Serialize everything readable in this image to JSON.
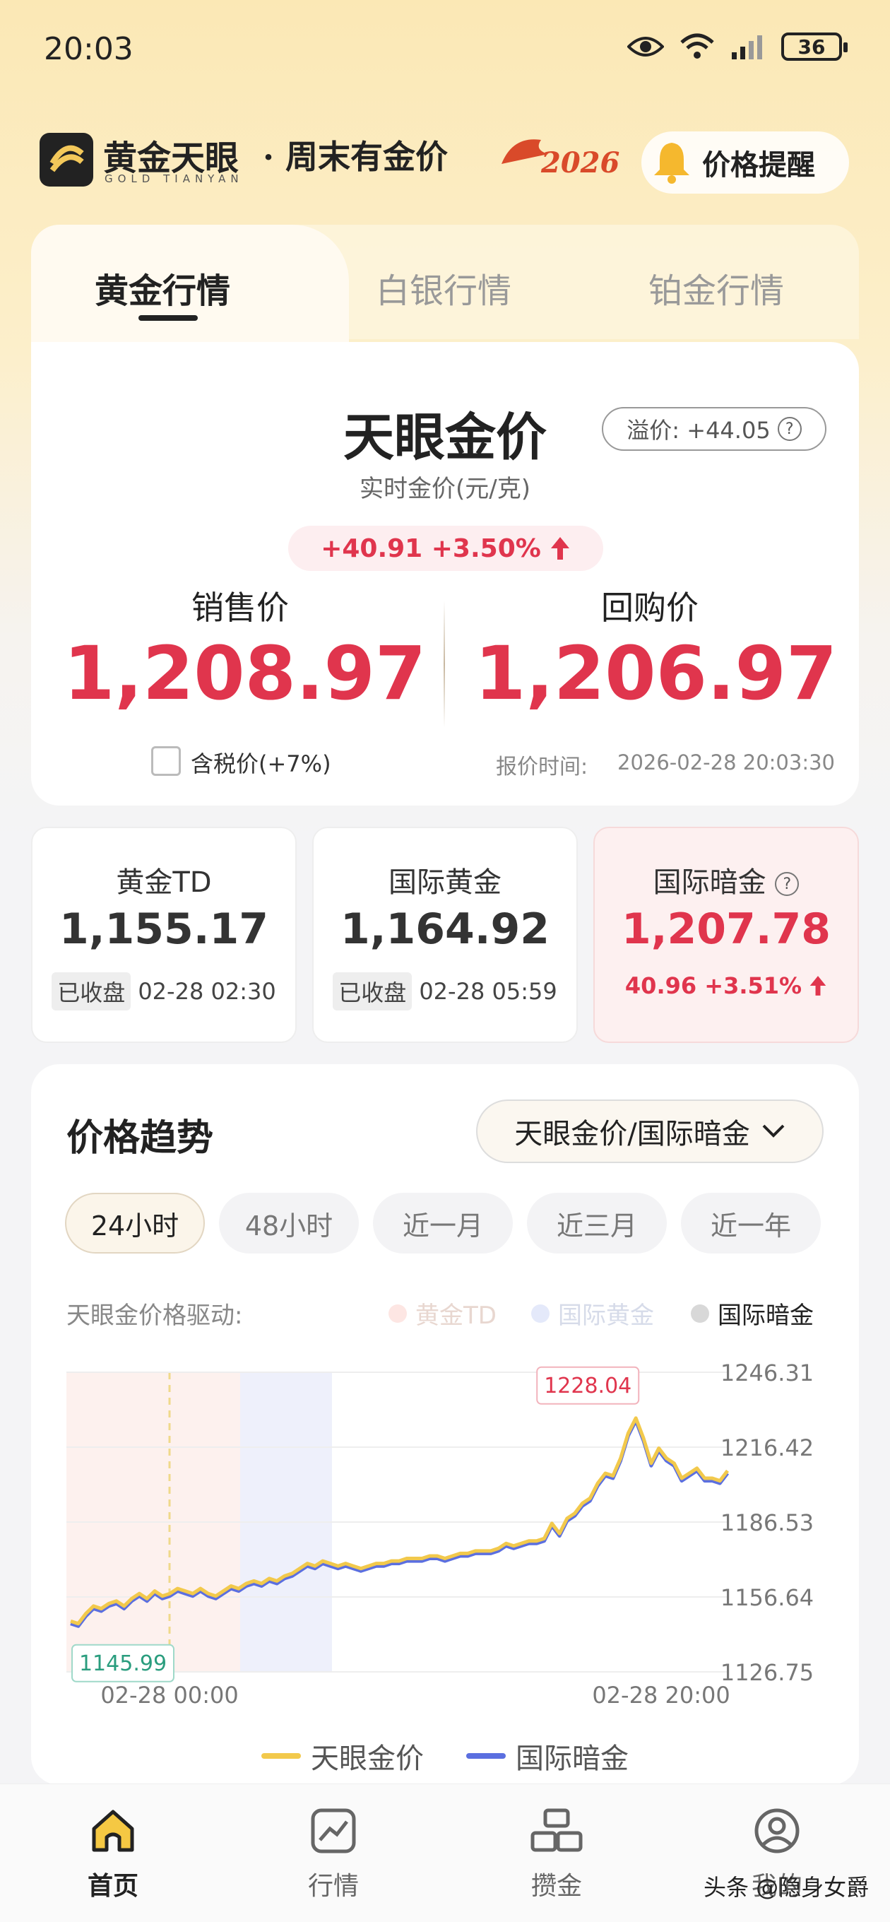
{
  "status_bar": {
    "time": "20:03",
    "battery": "36"
  },
  "header": {
    "brand_name": "黄金天眼",
    "brand_sub": "GOLD TIANYAN",
    "slogan": "· 周末有金价",
    "year_badge": "2026",
    "alert_button": "价格提醒"
  },
  "tabs": [
    {
      "label": "黄金行情",
      "active": true
    },
    {
      "label": "白银行情",
      "active": false
    },
    {
      "label": "铂金行情",
      "active": false
    }
  ],
  "price_card": {
    "title": "天眼金价",
    "premium": "溢价: +44.05",
    "unit": "实时金价(元/克)",
    "change": "+40.91 +3.50%",
    "sell_label": "销售价",
    "sell_price": "1,208.97",
    "buy_label": "回购价",
    "buy_price": "1,206.97",
    "tax_label": "含税价(+7%)",
    "quote_time_label": "报价时间:",
    "quote_time": "2026-02-28 20:03:30"
  },
  "markets": [
    {
      "name": "黄金TD",
      "value": "1,155.17",
      "status": "已收盘",
      "time": "02-28 02:30"
    },
    {
      "name": "国际黄金",
      "value": "1,164.92",
      "status": "已收盘",
      "time": "02-28 05:59"
    },
    {
      "name": "国际暗金",
      "value": "1,207.78",
      "change": "40.96 +3.51%"
    }
  ],
  "trend": {
    "title": "价格趋势",
    "select": "天眼金价/国际暗金",
    "ranges": [
      "24小时",
      "48小时",
      "近一月",
      "近三月",
      "近一年"
    ],
    "driver_label": "天眼金价格驱动:",
    "driver_legend": [
      "黄金TD",
      "国际黄金",
      "国际暗金"
    ]
  },
  "chart_data": {
    "type": "line",
    "x_ticks": [
      "02-28 00:00",
      "02-28 20:00"
    ],
    "y_ticks": [
      1246.31,
      1216.42,
      1186.53,
      1156.64,
      1126.75
    ],
    "ylim": [
      1126.75,
      1246.31
    ],
    "max_label": "1228.04",
    "min_label": "1145.99",
    "series": [
      {
        "name": "天眼金价",
        "color": "#f2c94c",
        "values": [
          1147,
          1146,
          1150,
          1153,
          1152,
          1154,
          1155,
          1153,
          1156,
          1158,
          1156,
          1159,
          1157,
          1158,
          1160,
          1159,
          1158,
          1160,
          1158,
          1157,
          1159,
          1161,
          1160,
          1162,
          1163,
          1162,
          1164,
          1163,
          1165,
          1166,
          1168,
          1170,
          1169,
          1171,
          1170,
          1169,
          1170,
          1169,
          1168,
          1169,
          1170,
          1170,
          1171,
          1171,
          1172,
          1172,
          1172,
          1173,
          1173,
          1172,
          1173,
          1174,
          1174,
          1175,
          1175,
          1175,
          1176,
          1178,
          1177,
          1178,
          1179,
          1179,
          1180,
          1186,
          1182,
          1188,
          1190,
          1194,
          1196,
          1202,
          1206,
          1205,
          1212,
          1222,
          1228,
          1220,
          1210,
          1216,
          1212,
          1210,
          1204,
          1206,
          1208,
          1204,
          1204,
          1203,
          1207
        ]
      },
      {
        "name": "国际暗金",
        "color": "#5b6fe0",
        "values": [
          1146,
          1145,
          1149,
          1152,
          1151,
          1153,
          1154,
          1152,
          1155,
          1157,
          1155,
          1158,
          1156,
          1157,
          1159,
          1158,
          1157,
          1159,
          1157,
          1156,
          1158,
          1160,
          1159,
          1161,
          1162,
          1161,
          1163,
          1162,
          1164,
          1165,
          1167,
          1169,
          1168,
          1170,
          1169,
          1168,
          1169,
          1168,
          1167,
          1168,
          1169,
          1169,
          1170,
          1170,
          1171,
          1171,
          1171,
          1172,
          1172,
          1171,
          1172,
          1173,
          1173,
          1174,
          1174,
          1174,
          1175,
          1177,
          1176,
          1177,
          1178,
          1178,
          1179,
          1185,
          1181,
          1187,
          1189,
          1193,
          1195,
          1201,
          1205,
          1204,
          1211,
          1221,
          1227,
          1219,
          1209,
          1215,
          1211,
          1209,
          1203,
          1205,
          1207,
          1203,
          1203,
          1202,
          1206
        ]
      }
    ]
  },
  "nav": [
    {
      "label": "首页",
      "icon": "home-icon",
      "active": true
    },
    {
      "label": "行情",
      "icon": "chart-icon",
      "active": false
    },
    {
      "label": "攒金",
      "icon": "stack-icon",
      "active": false
    },
    {
      "label": "我的",
      "icon": "user-icon",
      "active": false
    }
  ],
  "watermark": "头条 @隐身女爵",
  "colors": {
    "accent_red": "#e0354d",
    "gold_line": "#f2c94c",
    "blue_line": "#5b6fe0"
  }
}
